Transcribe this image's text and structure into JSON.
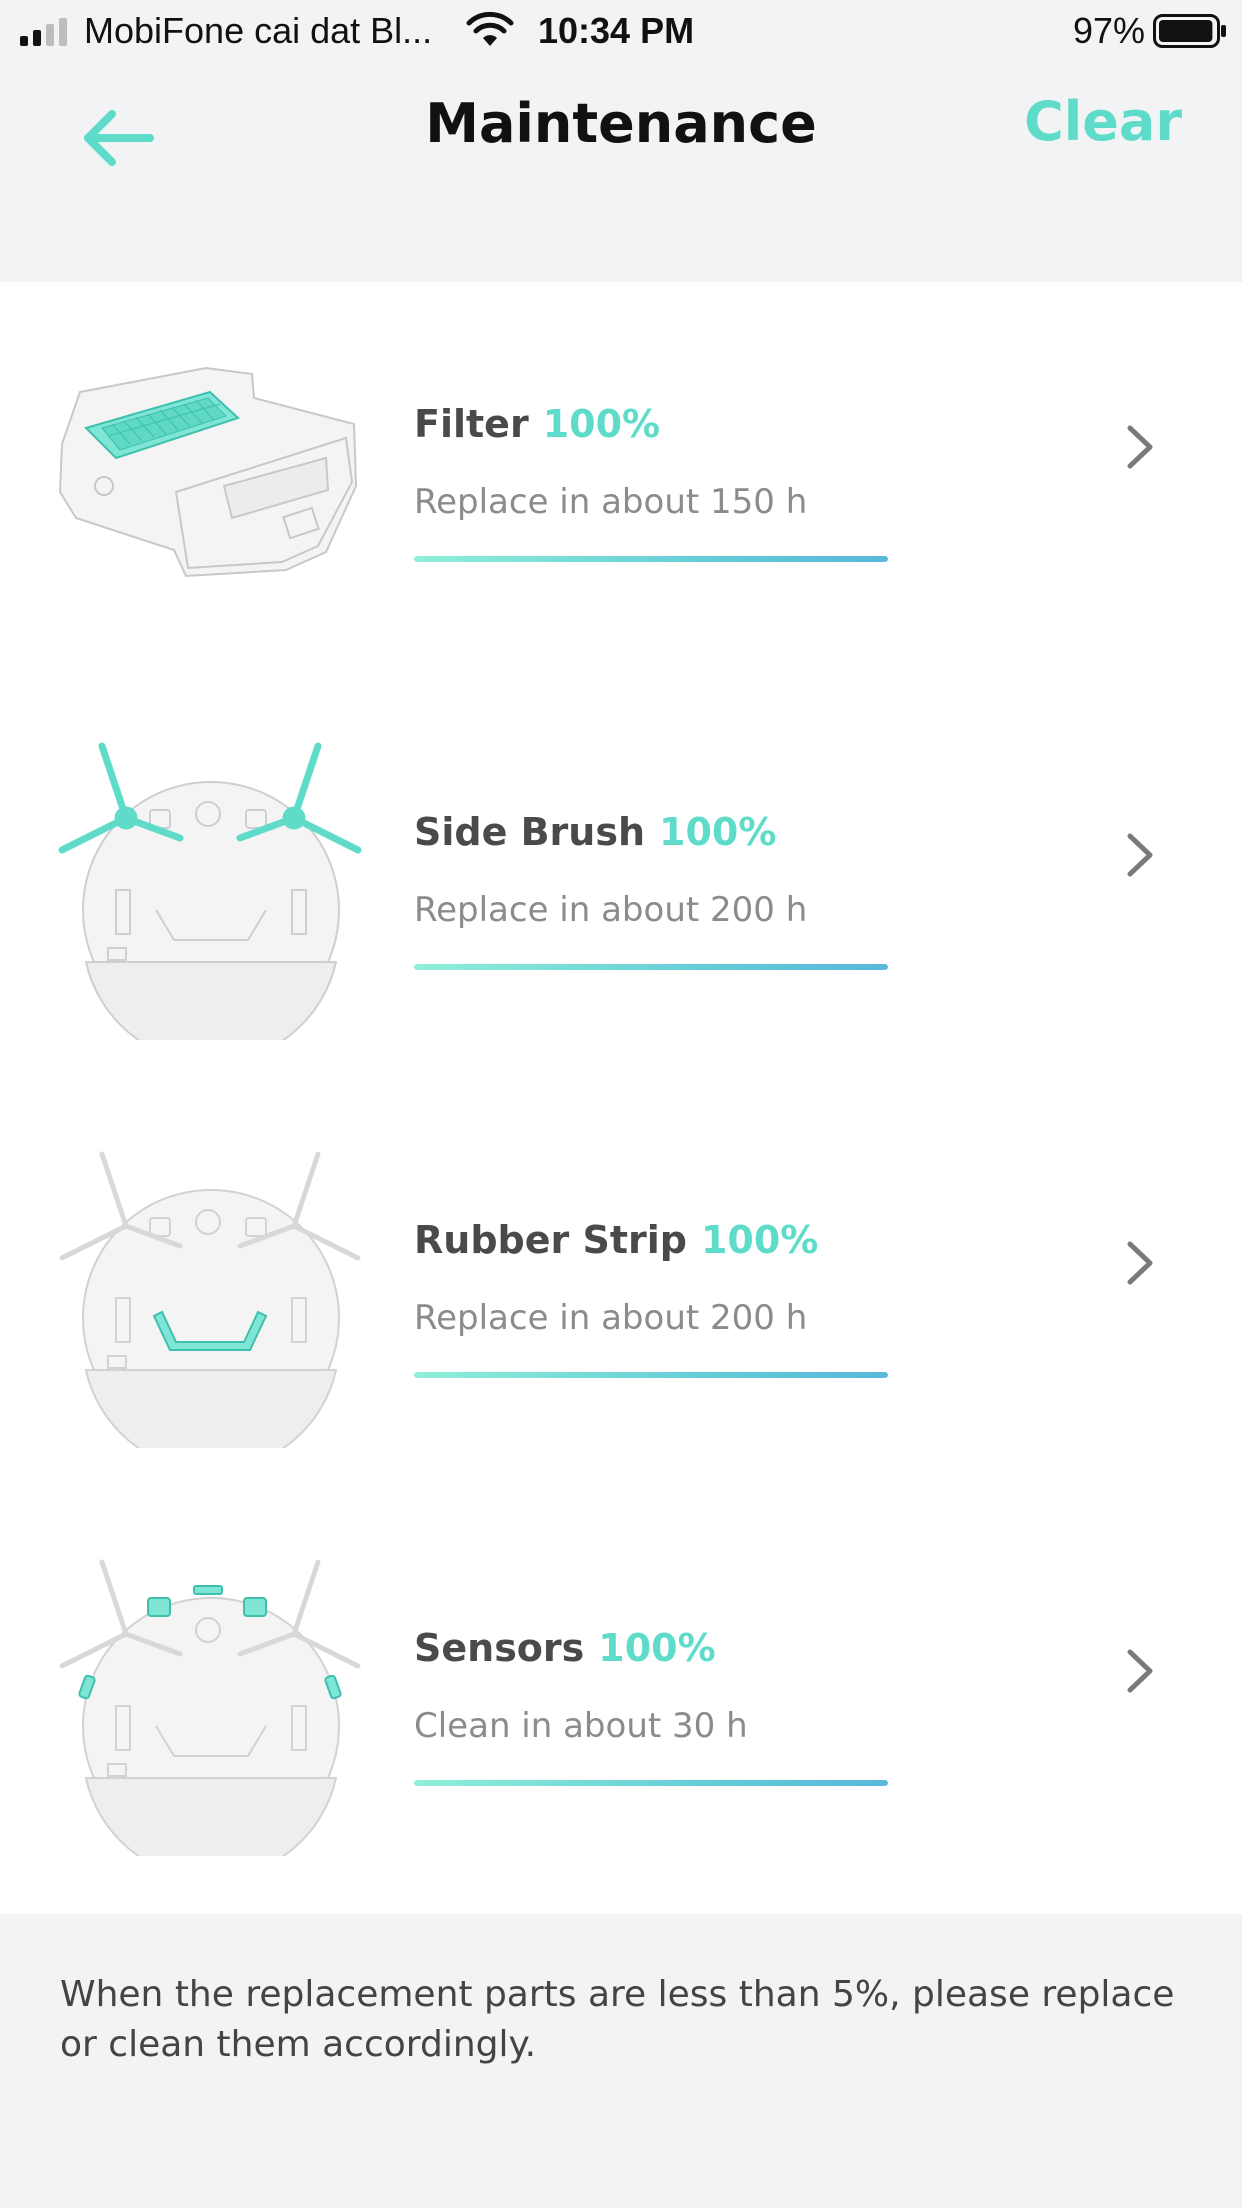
{
  "status_bar": {
    "carrier": "MobiFone cai dat Bl...",
    "time": "10:34 PM",
    "battery_percent": "97%",
    "signal_icon": "cellular-signal-icon",
    "wifi_icon": "wifi-icon",
    "battery_icon": "battery-icon",
    "battery_level": 0.97
  },
  "header": {
    "title": "Maintenance",
    "clear_label": "Clear",
    "back_icon": "arrow-left-icon"
  },
  "colors": {
    "accent": "#5fdcc9",
    "progress_start": "#8ef0d8",
    "progress_end": "#5ab7dc"
  },
  "items": [
    {
      "name": "Filter",
      "percent": "100%",
      "subtitle": "Replace in about 150 h",
      "progress": 1.0,
      "icon": "filter-illustration"
    },
    {
      "name": "Side Brush",
      "percent": "100%",
      "subtitle": "Replace in about 200 h",
      "progress": 1.0,
      "icon": "side-brush-illustration"
    },
    {
      "name": "Rubber Strip",
      "percent": "100%",
      "subtitle": "Replace in about 200 h",
      "progress": 1.0,
      "icon": "rubber-strip-illustration"
    },
    {
      "name": "Sensors",
      "percent": "100%",
      "subtitle": "Clean in about 30 h",
      "progress": 1.0,
      "icon": "sensors-illustration"
    }
  ],
  "footer": {
    "note": "When the replacement parts are less than 5%, please replace or clean them accordingly."
  }
}
